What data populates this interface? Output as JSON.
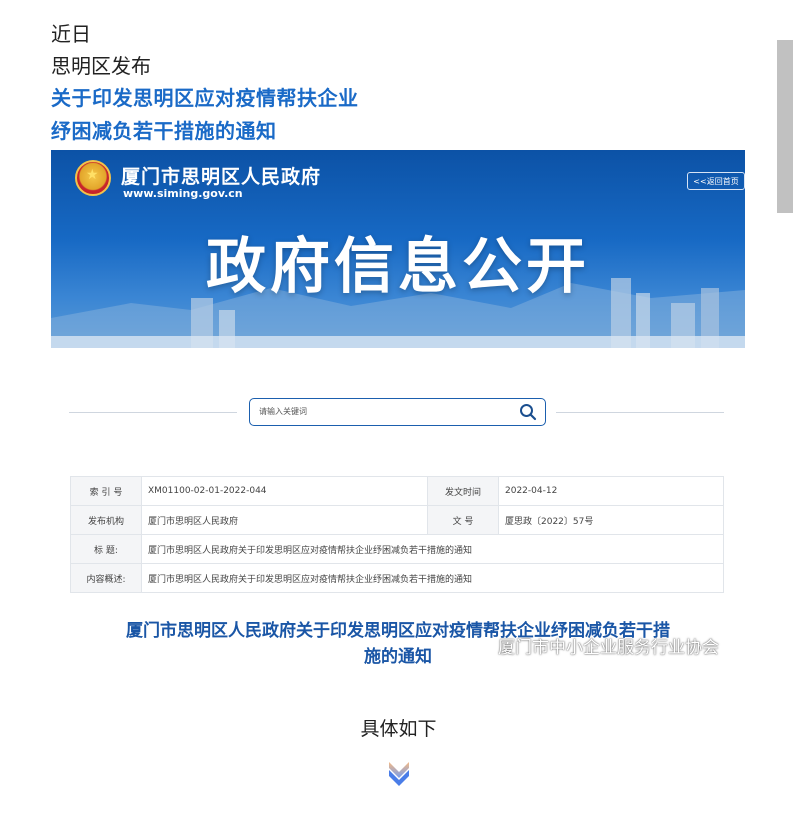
{
  "intro": {
    "line1": "近日",
    "line2": "思明区发布",
    "title_line1": "关于印发思明区应对疫情帮扶企业",
    "title_line2": "纾困减负若干措施的通知"
  },
  "banner": {
    "site_name": "厦门市思明区人民政府",
    "site_url": "www.siming.gov.cn",
    "back_label": "<<返回首页",
    "heading": "政府信息公开",
    "emblem_icon": "national-emblem",
    "colors": {
      "primary": "#1769c4",
      "dark": "#0c52a6"
    }
  },
  "search": {
    "placeholder": "请输入关键词",
    "icon": "search-icon"
  },
  "info_table": {
    "index_label": "索 引 号",
    "index_value": "XM01100-02-01-2022-044",
    "date_label": "发文时间",
    "date_value": "2022-04-12",
    "org_label": "发布机构",
    "org_value": "厦门市思明区人民政府",
    "doc_label": "文 号",
    "doc_value": "厦思政〔2022〕57号",
    "subject_label": "标 题:",
    "subject_value": "厦门市思明区人民政府关于印发思明区应对疫情帮扶企业纾困减负若干措施的通知",
    "summary_label": "内容概述:",
    "summary_value": "厦门市思明区人民政府关于印发思明区应对疫情帮扶企业纾困减负若干措施的通知"
  },
  "notice_title": {
    "line1": "厦门市思明区人民政府关于印发思明区应对疫情帮扶企业纾困减负若干措",
    "line2": "施的通知"
  },
  "watermark": "厦门市中小企业服务行业协会",
  "detail": "具体如下",
  "decor": {
    "chevron_icon": "double-chevron-down-icon",
    "chevron_color": "#4a7de8"
  }
}
